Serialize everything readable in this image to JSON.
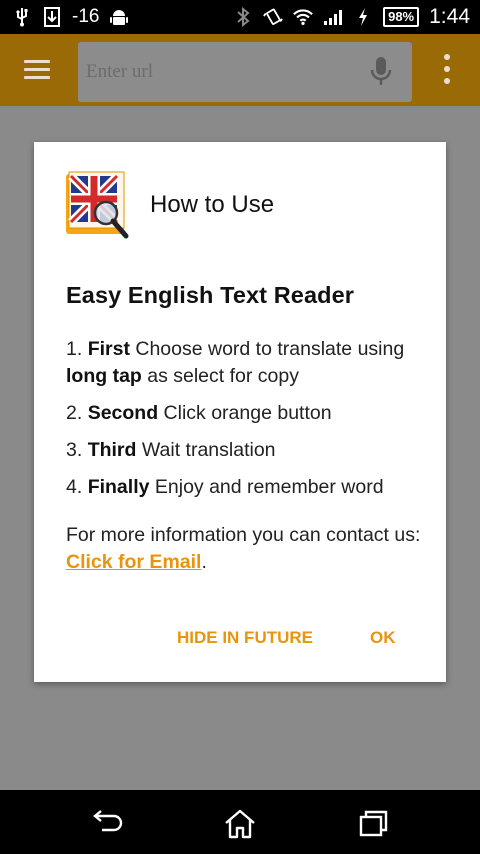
{
  "status_bar": {
    "signal_label": "-16",
    "battery": "98%",
    "time": "1:44",
    "icons": [
      "usb-icon",
      "screenshot-icon",
      "android-icon",
      "bluetooth-icon",
      "vibrate-icon",
      "wifi-icon",
      "cell-signal-icon",
      "charging-icon"
    ]
  },
  "app_bar": {
    "url_placeholder": "Enter url",
    "icons": [
      "menu-icon",
      "mic-icon",
      "overflow-icon"
    ],
    "color": "#9a6a06"
  },
  "dialog": {
    "title": "How to Use",
    "app_name": "Easy English Text Reader",
    "steps": [
      {
        "num": "1.",
        "bold": "First",
        "text1": " Choose word to translate using ",
        "bold2": "long tap",
        "text2": " as select for copy"
      },
      {
        "num": "2.",
        "bold": "Second",
        "text1": " Click orange button"
      },
      {
        "num": "3.",
        "bold": "Third",
        "text1": " Wait translation"
      },
      {
        "num": "4.",
        "bold": "Finally",
        "text1": " Enjoy and remember word"
      }
    ],
    "info_text": "For more information you can contact us: ",
    "email_link": "Click for Email",
    "info_end": ".",
    "buttons": {
      "hide": "HIDE IN FUTURE",
      "ok": "OK"
    },
    "accent_color": "#e8940d"
  },
  "nav_bar": {
    "icons": [
      "back-icon",
      "home-icon",
      "recents-icon"
    ]
  }
}
